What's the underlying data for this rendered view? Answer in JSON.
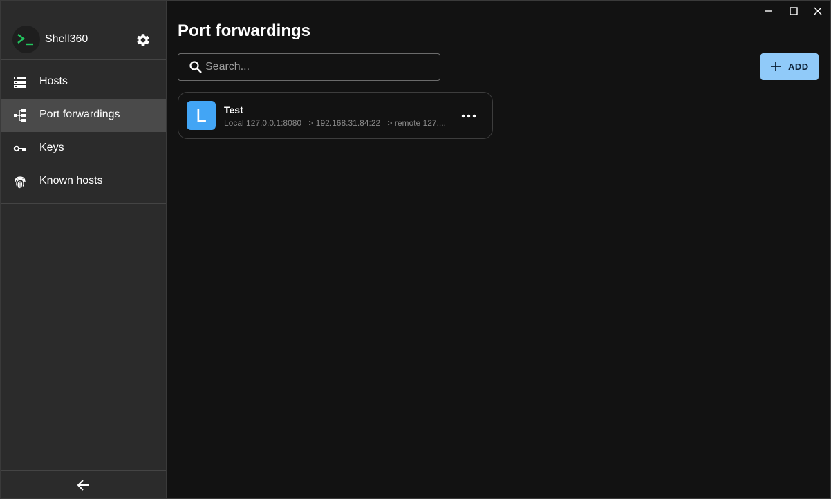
{
  "app": {
    "name": "Shell360"
  },
  "sidebar": {
    "items": [
      {
        "label": "Hosts",
        "icon": "server-icon",
        "active": false
      },
      {
        "label": "Port forwardings",
        "icon": "port-forwarding-icon",
        "active": true
      },
      {
        "label": "Keys",
        "icon": "key-icon",
        "active": false
      },
      {
        "label": "Known hosts",
        "icon": "fingerprint-icon",
        "active": false
      }
    ]
  },
  "main": {
    "title": "Port forwardings",
    "search": {
      "placeholder": "Search...",
      "value": ""
    },
    "add_button": {
      "label": "ADD"
    },
    "items": [
      {
        "avatar_letter": "L",
        "name": "Test",
        "description": "Local 127.0.0.1:8080 => 192.168.31.84:22 => remote 127...."
      }
    ]
  },
  "colors": {
    "accent": "#90caf9",
    "avatar": "#42a5f5",
    "logo_green": "#22c55e",
    "sidebar_bg": "#2b2b2b",
    "main_bg": "#121212"
  }
}
